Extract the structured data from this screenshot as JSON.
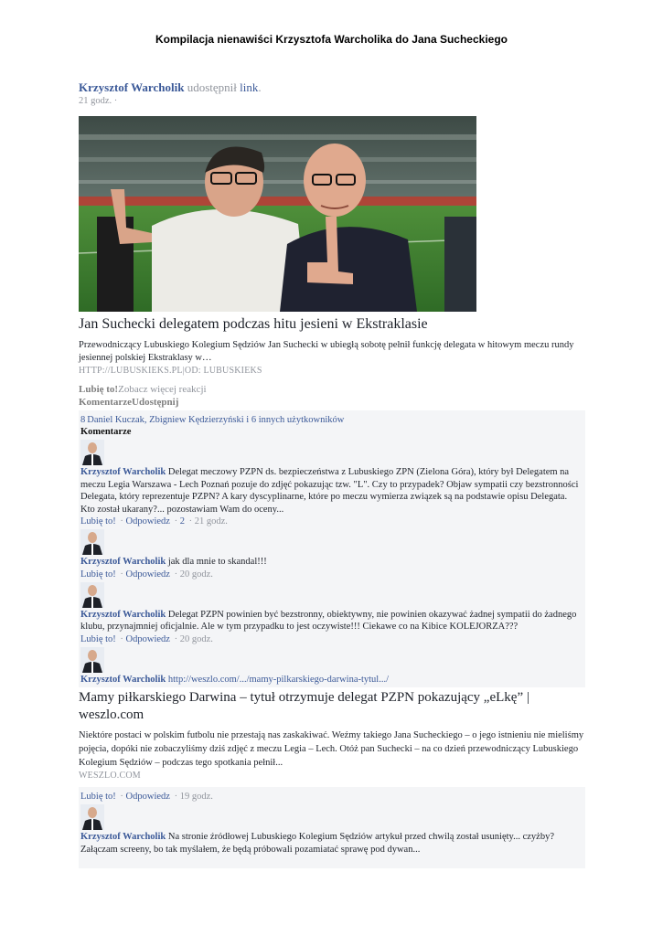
{
  "doc_title": "Kompilacja nienawiści Krzysztofa Warcholika do Jana Sucheckiego",
  "post": {
    "author": "Krzysztof Warcholik",
    "action": "udostępnił",
    "link_word": "link",
    "period": ".",
    "time": "21 godz. ·",
    "headline": "Jan Suchecki delegatem podczas hitu jesieni w Ekstraklasie",
    "description": "Przewodniczący Lubuskiego Kolegium Sędziów Jan Suchecki w ubiegłą sobotę pełnił funkcję delegata w hitowym meczu rundy jesiennej polskiej Ekstraklasy w…",
    "source": "HTTP://LUBUSKIEKS.PL|OD: LUBUSKIEKS",
    "like_label": "Lubię to!",
    "more_reactions": "Zobacz więcej reakcji",
    "comment_share": "KomentarzeUdostępnij"
  },
  "reactions": {
    "count": "8",
    "names": "Daniel Kuczak, Zbigniew Kędzierzyński i 6 innych użytkowników"
  },
  "comments_heading": "Komentarze",
  "comments": [
    {
      "author": "Krzysztof Warcholik",
      "text": "Delegat meczowy PZPN ds. bezpieczeństwa z Lubuskiego ZPN (Zielona Góra), który był Delegatem na meczu Legia Warszawa - Lech Poznań pozuje do zdjęć pokazując tzw. \"L\". Czy to przypadek? Objaw sympatii czy bezstronności Delegata, który reprezentuje PZPN? A kary dyscyplinarne, które po meczu wymierza związek są na podstawie opisu Delegata. Kto został ukarany?... pozostawiam Wam do oceny...",
      "like": "Lubię to!",
      "reply": "Odpowiedz",
      "likes_count": "2",
      "time": "21 godz."
    },
    {
      "author": "Krzysztof Warcholik",
      "text": "jak dla mnie to skandal!!!",
      "like": "Lubię to!",
      "reply": "Odpowiedz",
      "time": "20 godz."
    },
    {
      "author": "Krzysztof Warcholik",
      "text": "Delegat PZPN powinien być bezstronny, obiektywny, nie powinien okazywać żadnej sympatii do żadnego klubu, przynajmniej oficjalnie. Ale w tym przypadku to jest oczywiste!!! Ciekawe co na Kibice KOLEJORZA???",
      "like": "Lubię to!",
      "reply": "Odpowiedz",
      "time": "20 godz."
    },
    {
      "author": "Krzysztof Warcholik",
      "link": "http://weszlo.com/.../mamy-pilkarskiego-darwina-tytul.../",
      "preview_title": "Mamy piłkarskiego Darwina – tytuł otrzymuje delegat PZPN pokazujący „eLkę” | weszlo.com",
      "preview_desc": "Niektóre postaci w polskim futbolu nie przestają nas zaskakiwać. Weźmy takiego Jana Sucheckiego – o jego istnieniu nie mieliśmy pojęcia, dopóki nie zobaczyliśmy dziś zdjęć z meczu Legia – Lech. Otóż pan Suchecki – na co dzień przewodniczący Lubuskiego Kolegium Sędziów – podczas tego spotkania pełnił...",
      "preview_source": "WESZLO.COM",
      "like": "Lubię to!",
      "reply": "Odpowiedz",
      "time": "19 godz."
    },
    {
      "author": "Krzysztof Warcholik",
      "text": "Na stronie źródłowej Lubuskiego Kolegium Sędziów artykuł przed chwilą został usunięty... czyżby? Załączam screeny, bo tak myślałem, że będą próbowali pozamiatać sprawę pod dywan..."
    }
  ]
}
